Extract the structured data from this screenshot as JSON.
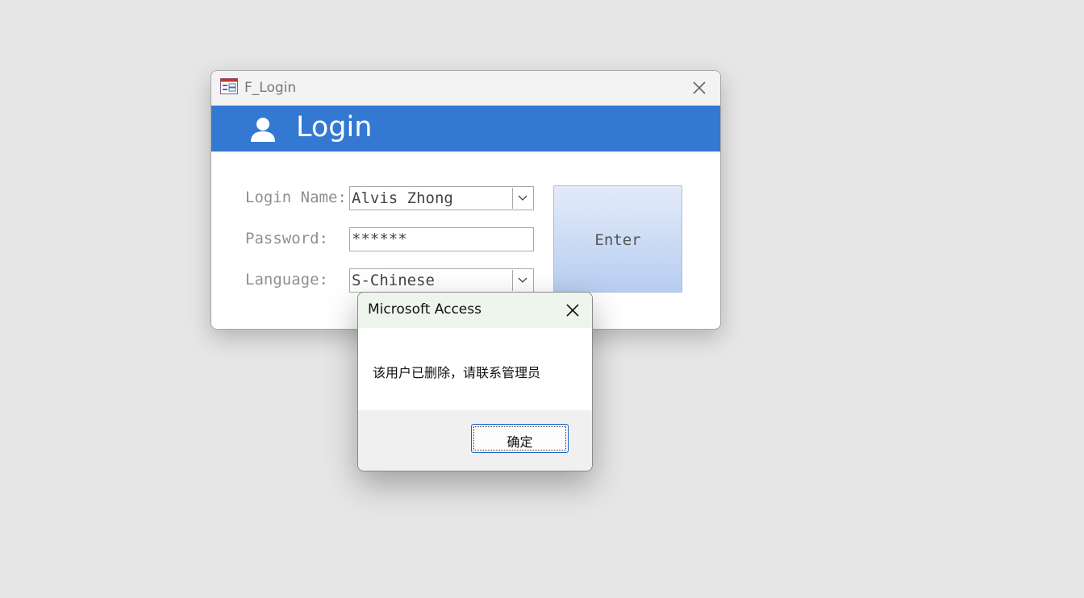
{
  "login_window": {
    "title": "F_Login",
    "header": "Login",
    "fields": {
      "login_name": {
        "label": "Login Name:",
        "value": "Alvis Zhong"
      },
      "password": {
        "label": "Password:",
        "value": "******"
      },
      "language": {
        "label": "Language:",
        "value": "S-Chinese"
      }
    },
    "enter_label": "Enter",
    "colors": {
      "banner": "#3379d1",
      "enter_button": "#c9d9f5"
    }
  },
  "message_box": {
    "title": "Microsoft Access",
    "message": "该用户已删除，请联系管理员",
    "ok_label": "确定"
  }
}
